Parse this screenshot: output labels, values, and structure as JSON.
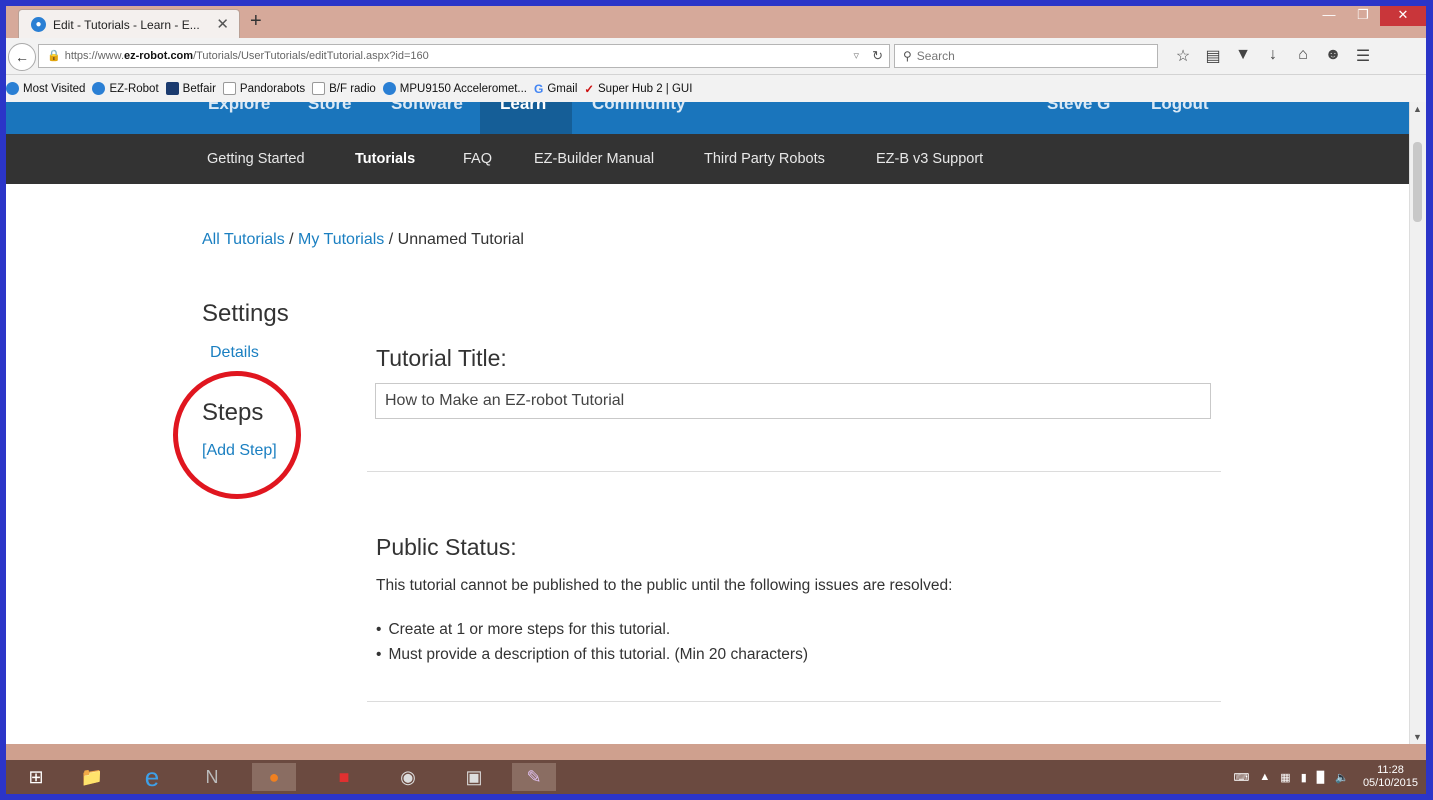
{
  "browser": {
    "tab_title": "Edit - Tutorials - Learn - E...",
    "url_prefix": "https://www.",
    "url_domain": "ez-robot.com",
    "url_path": "/Tutorials/UserTutorials/editTutorial.aspx?id=160",
    "search_placeholder": "Search",
    "bookmarks": [
      "Most Visited",
      "EZ-Robot",
      "Betfair",
      "Pandorabots",
      "B/F radio",
      "MPU9150 Acceleromet...",
      "Gmail",
      "Super Hub 2 | GUI"
    ]
  },
  "site": {
    "top_nav": [
      "Explore",
      "Store",
      "Software",
      "Learn",
      "Community"
    ],
    "user": "Steve G",
    "logout": "Logout",
    "sub_nav": [
      "Getting Started",
      "Tutorials",
      "FAQ",
      "EZ-Builder Manual",
      "Third Party Robots",
      "EZ-B v3 Support"
    ]
  },
  "breadcrumb": {
    "all": "All Tutorials",
    "sep1": " / ",
    "mine": "My Tutorials",
    "sep2": " / ",
    "current": "Unnamed Tutorial"
  },
  "sidebar": {
    "settings_heading": "Settings",
    "details_link": "Details",
    "steps_heading": "Steps",
    "add_step_link": "[Add Step]"
  },
  "form": {
    "title_label": "Tutorial Title:",
    "title_value": "How to Make an EZ-robot Tutorial",
    "public_status_label": "Public Status:",
    "public_status_text": "This tutorial cannot be published to the public until the following issues are resolved:",
    "issues": [
      "Create at 1 or more steps for this tutorial.",
      "Must provide a description of this tutorial. (Min 20 characters)"
    ]
  },
  "taskbar": {
    "time": "11:28",
    "date": "05/10/2015"
  },
  "colors": {
    "site_blue": "#1a75bc",
    "subnav_dark": "#333333",
    "link_blue": "#1a7fc1",
    "annotation_red": "#e0161f"
  }
}
